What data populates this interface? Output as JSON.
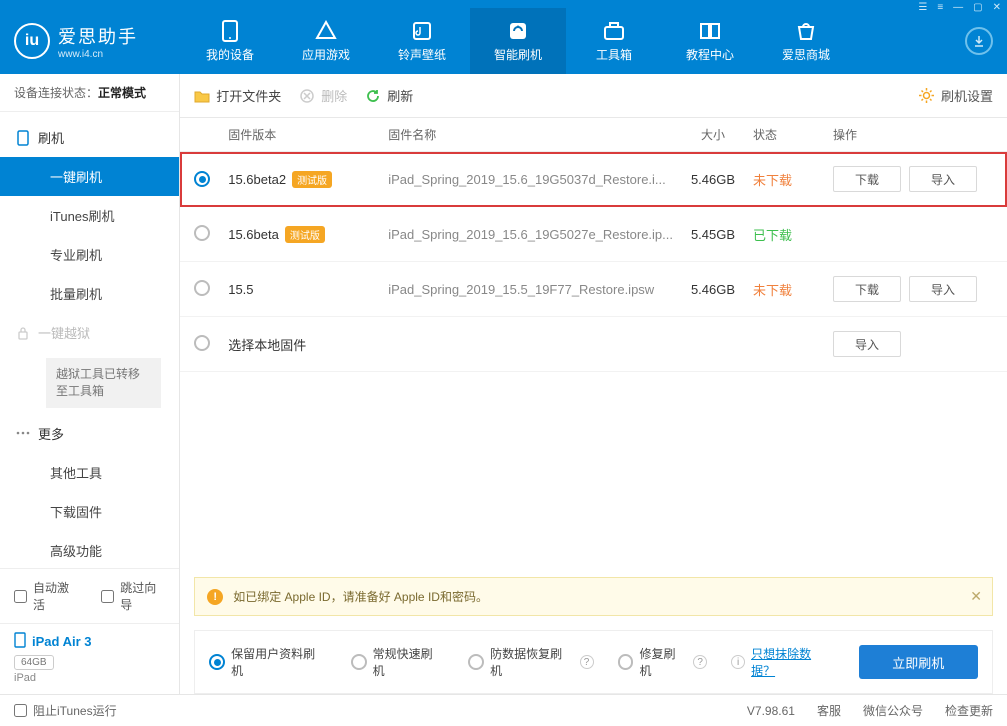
{
  "app": {
    "title": "爱思助手",
    "site": "www.i4.cn"
  },
  "nav": {
    "items": [
      {
        "label": "我的设备"
      },
      {
        "label": "应用游戏"
      },
      {
        "label": "铃声壁纸"
      },
      {
        "label": "智能刷机"
      },
      {
        "label": "工具箱"
      },
      {
        "label": "教程中心"
      },
      {
        "label": "爱思商城"
      }
    ]
  },
  "sidebar": {
    "conn_label": "设备连接状态：",
    "conn_status": "正常模式",
    "flash_head": "刷机",
    "subs": [
      "一键刷机",
      "iTunes刷机",
      "专业刷机",
      "批量刷机"
    ],
    "jailbreak_head": "一键越狱",
    "jailbreak_note": "越狱工具已转移至工具箱",
    "more_head": "更多",
    "more_subs": [
      "其他工具",
      "下载固件",
      "高级功能"
    ],
    "auto_activate": "自动激活",
    "skip_guide": "跳过向导",
    "device_name": "iPad Air 3",
    "device_storage": "64GB",
    "device_type": "iPad"
  },
  "toolbar": {
    "open_folder": "打开文件夹",
    "delete": "删除",
    "refresh": "刷新",
    "settings": "刷机设置"
  },
  "table": {
    "h_version": "固件版本",
    "h_name": "固件名称",
    "h_size": "大小",
    "h_status": "状态",
    "h_ops": "操作",
    "beta_tag": "测试版",
    "rows": [
      {
        "selected": true,
        "version": "15.6beta2",
        "beta": true,
        "name": "iPad_Spring_2019_15.6_19G5037d_Restore.i...",
        "size": "5.46GB",
        "status": "未下载",
        "status_class": "orange",
        "ops": [
          "下载",
          "导入"
        ],
        "highlight": true
      },
      {
        "selected": false,
        "version": "15.6beta",
        "beta": true,
        "name": "iPad_Spring_2019_15.6_19G5027e_Restore.ip...",
        "size": "5.45GB",
        "status": "已下载",
        "status_class": "green",
        "ops": []
      },
      {
        "selected": false,
        "version": "15.5",
        "beta": false,
        "name": "iPad_Spring_2019_15.5_19F77_Restore.ipsw",
        "size": "5.46GB",
        "status": "未下载",
        "status_class": "orange",
        "ops": [
          "下载",
          "导入"
        ]
      },
      {
        "selected": false,
        "version": "选择本地固件",
        "beta": false,
        "name": "",
        "size": "",
        "status": "",
        "status_class": "",
        "ops": [
          "导入"
        ]
      }
    ]
  },
  "warn": {
    "text": "如已绑定 Apple ID，请准备好 Apple ID和密码。"
  },
  "flash_opts": {
    "o1": "保留用户资料刷机",
    "o2": "常规快速刷机",
    "o3": "防数据恢复刷机",
    "o4": "修复刷机",
    "erase_link": "只想抹除数据？",
    "go": "立即刷机"
  },
  "footer": {
    "block_itunes": "阻止iTunes运行",
    "version": "V7.98.61",
    "f1": "客服",
    "f2": "微信公众号",
    "f3": "检查更新"
  }
}
